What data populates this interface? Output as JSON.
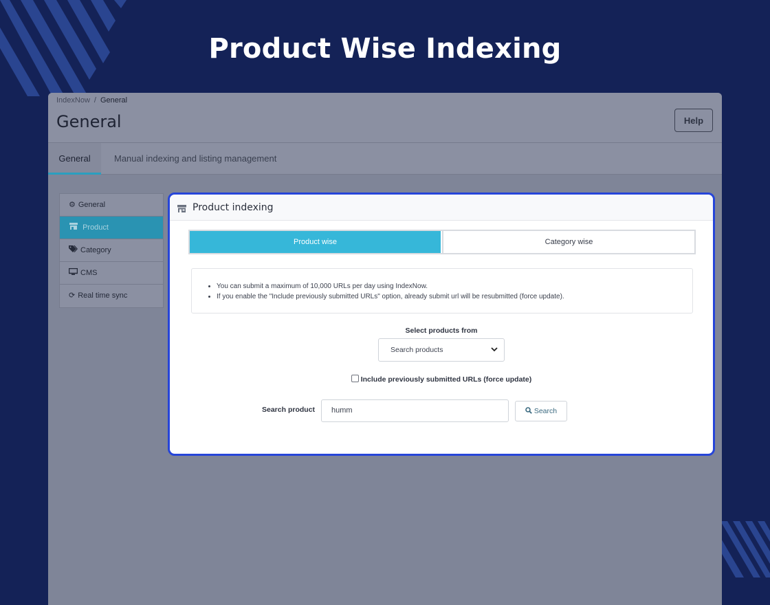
{
  "hero": {
    "title": "Product Wise Indexing"
  },
  "header": {
    "breadcrumb": [
      "IndexNow",
      "General"
    ],
    "breadcrumb_sep": "/",
    "page_title": "General",
    "help_label": "Help"
  },
  "tabs": [
    {
      "label": "General",
      "active": true
    },
    {
      "label": "Manual indexing and listing management",
      "active": false
    }
  ],
  "sidebar": {
    "items": [
      {
        "label": "General",
        "icon": "gear-icon",
        "active": false
      },
      {
        "label": "Product",
        "icon": "store-icon",
        "active": true
      },
      {
        "label": "Category",
        "icon": "tags-icon",
        "active": false
      },
      {
        "label": "CMS",
        "icon": "monitor-icon",
        "active": false
      },
      {
        "label": "Real time sync",
        "icon": "refresh-icon",
        "active": false
      }
    ]
  },
  "panel": {
    "title": "Product indexing",
    "switcher": {
      "active_label": "Product wise",
      "other_label": "Category wise"
    },
    "info": [
      "You can submit a maximum of 10,000 URLs per day using IndexNow.",
      "If you enable the \"Include previously submitted URLs\" option, already submit url will be resubmitted (force update)."
    ],
    "select_label": "Select products from",
    "select_value": "Search products",
    "checkbox_label": "Include previously submitted URLs (force update)",
    "checkbox_checked": false,
    "search_label": "Search product",
    "search_value": "humm",
    "search_button": "Search"
  },
  "colors": {
    "background": "#142257",
    "accent": "#36b7d9",
    "panel_border": "#2645d9"
  }
}
